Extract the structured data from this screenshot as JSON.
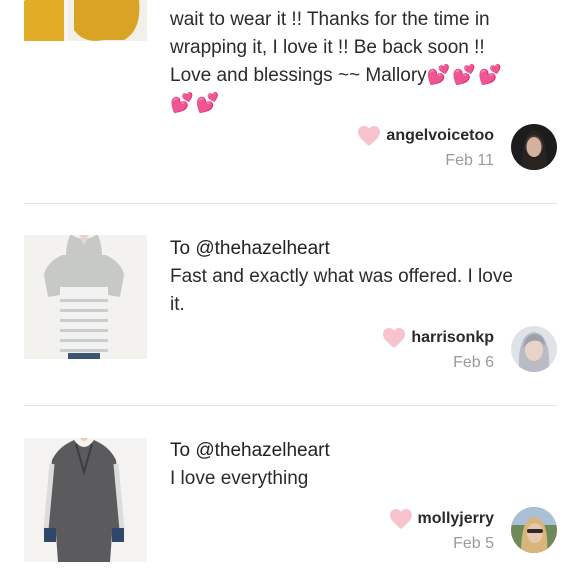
{
  "reviews": [
    {
      "to": "",
      "body_lines": [
        "wait to wear it !! Thanks for the time in",
        "wrapping it, I love it !! Be back soon !!",
        "Love and blessings ~~ Mallory"
      ],
      "inline_hearts": "💕💕💕",
      "trailing_hearts": "💕💕",
      "username": "angelvoicetoo",
      "date": "Feb 11"
    },
    {
      "to": "To @thehazelheart",
      "body_lines": [
        "Fast and exactly what was offered. I love",
        "it."
      ],
      "username": "harrisonkp",
      "date": "Feb 6"
    },
    {
      "to": "To @thehazelheart",
      "body_lines": [
        "I love everything"
      ],
      "username": "mollyjerry",
      "date": "Feb 5"
    }
  ],
  "colors": {
    "like_heart": "#f6c3cf",
    "emoji_heart": "#e8418a",
    "date_gray": "#9a9a9a",
    "divider": "#e3e3e3"
  },
  "icons": {
    "like": "heart-icon",
    "emoji": "two-hearts-emoji"
  }
}
